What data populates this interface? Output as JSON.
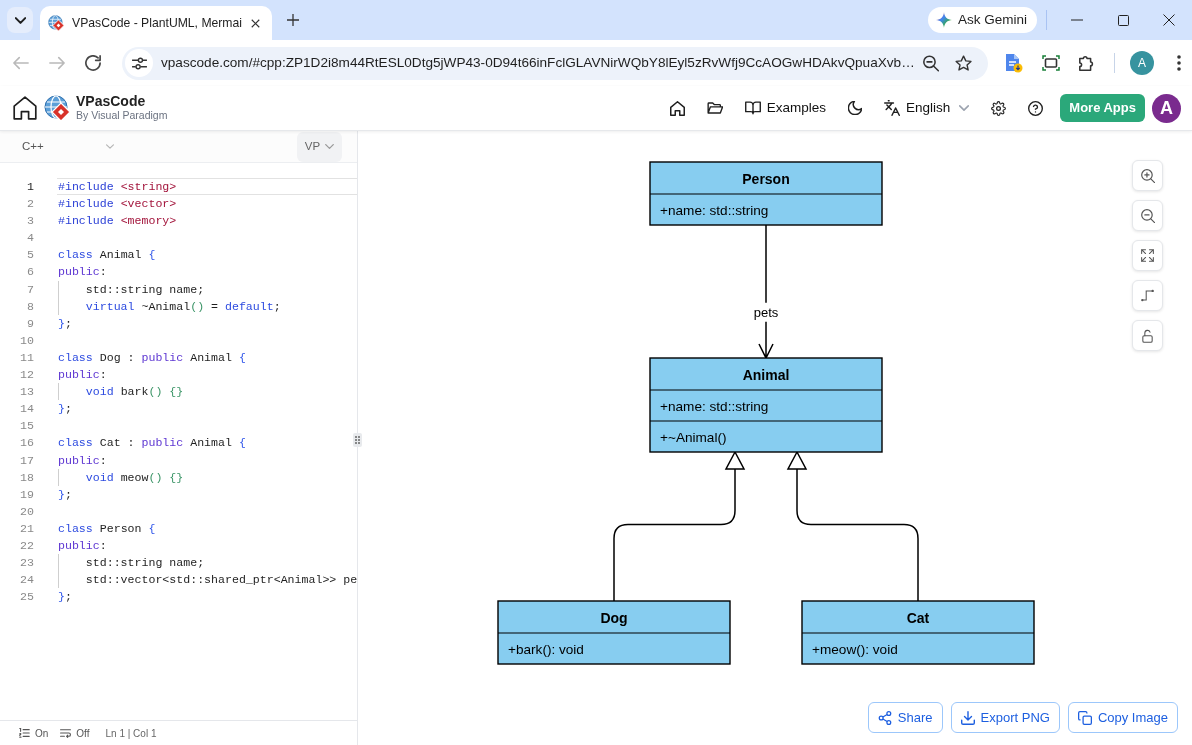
{
  "browser": {
    "tab_title": "VPasCode - PlantUML, Mermai",
    "url": "vpascode.com/#cpp:ZP1D2i8m44RtESL0Dtg5jWP43-0D94t66inFclGLAVNirWQbY8lEyl5zRvWfj9CcAOGwHDAkvQpuaXvb…",
    "back": {
      "disabled": true
    },
    "forward": {
      "disabled": true
    },
    "gemini_button": "Ask Gemini",
    "profile_initial": "A"
  },
  "app_header": {
    "title": "VPasCode",
    "subtitle": "By Visual Paradigm",
    "examples": "Examples",
    "language": "English",
    "more_apps": "More Apps",
    "user_initial": "A"
  },
  "editor": {
    "language": "C++",
    "renderer": "VP",
    "lines": [
      {
        "number": "1",
        "active": true,
        "tokens": [
          {
            "kind": "directive",
            "text": "#include"
          },
          {
            "kind": "header",
            "text": " <string>"
          }
        ]
      },
      {
        "number": "2",
        "active": false,
        "tokens": [
          {
            "kind": "directive",
            "text": "#include"
          },
          {
            "kind": "header",
            "text": " <vector>"
          }
        ]
      },
      {
        "number": "3",
        "active": false,
        "tokens": [
          {
            "kind": "directive",
            "text": "#include"
          },
          {
            "kind": "header",
            "text": " <memory>"
          }
        ]
      },
      {
        "number": "4",
        "active": false
      },
      {
        "number": "5",
        "active": false,
        "tokens": [
          {
            "kind": "keyword",
            "text": "class"
          },
          {
            "kind": "plain",
            "text": " Animal "
          },
          {
            "kind": "bracket1",
            "text": "{"
          }
        ]
      },
      {
        "number": "6",
        "active": false,
        "tokens": [
          {
            "kind": "access",
            "text": "public"
          },
          {
            "kind": "plain",
            "text": ":"
          }
        ]
      },
      {
        "number": "7",
        "active": false,
        "tokens": [
          {
            "kind": "indent"
          },
          {
            "kind": "plain",
            "text": "std::string name;"
          }
        ]
      },
      {
        "number": "8",
        "active": false,
        "tokens": [
          {
            "kind": "indent"
          },
          {
            "kind": "keyword",
            "text": "virtual"
          },
          {
            "kind": "plain",
            "text": " ~Animal"
          },
          {
            "kind": "bracket2",
            "text": "()"
          },
          {
            "kind": "plain",
            "text": " = "
          },
          {
            "kind": "keyword",
            "text": "default"
          },
          {
            "kind": "plain",
            "text": ";"
          }
        ]
      },
      {
        "number": "9",
        "active": false,
        "tokens": [
          {
            "kind": "bracket1",
            "text": "}"
          },
          {
            "kind": "plain",
            "text": ";"
          }
        ]
      },
      {
        "number": "10",
        "active": false
      },
      {
        "number": "11",
        "active": false,
        "tokens": [
          {
            "kind": "keyword",
            "text": "class"
          },
          {
            "kind": "plain",
            "text": " Dog : "
          },
          {
            "kind": "access",
            "text": "public"
          },
          {
            "kind": "plain",
            "text": " Animal "
          },
          {
            "kind": "bracket1",
            "text": "{"
          }
        ]
      },
      {
        "number": "12",
        "active": false,
        "tokens": [
          {
            "kind": "access",
            "text": "public"
          },
          {
            "kind": "plain",
            "text": ":"
          }
        ]
      },
      {
        "number": "13",
        "active": false,
        "tokens": [
          {
            "kind": "indent"
          },
          {
            "kind": "keyword",
            "text": "void"
          },
          {
            "kind": "plain",
            "text": " bark"
          },
          {
            "kind": "bracket2",
            "text": "()"
          },
          {
            "kind": "bracket2",
            "text": " {}"
          }
        ]
      },
      {
        "number": "14",
        "active": false,
        "tokens": [
          {
            "kind": "bracket1",
            "text": "}"
          },
          {
            "kind": "plain",
            "text": ";"
          }
        ]
      },
      {
        "number": "15",
        "active": false
      },
      {
        "number": "16",
        "active": false,
        "tokens": [
          {
            "kind": "keyword",
            "text": "class"
          },
          {
            "kind": "plain",
            "text": " Cat : "
          },
          {
            "kind": "access",
            "text": "public"
          },
          {
            "kind": "plain",
            "text": " Animal "
          },
          {
            "kind": "bracket1",
            "text": "{"
          }
        ]
      },
      {
        "number": "17",
        "active": false,
        "tokens": [
          {
            "kind": "access",
            "text": "public"
          },
          {
            "kind": "plain",
            "text": ":"
          }
        ]
      },
      {
        "number": "18",
        "active": false,
        "tokens": [
          {
            "kind": "indent"
          },
          {
            "kind": "keyword",
            "text": "void"
          },
          {
            "kind": "plain",
            "text": " meow"
          },
          {
            "kind": "bracket2",
            "text": "()"
          },
          {
            "kind": "bracket2",
            "text": " {}"
          }
        ]
      },
      {
        "number": "19",
        "active": false,
        "tokens": [
          {
            "kind": "bracket1",
            "text": "}"
          },
          {
            "kind": "plain",
            "text": ";"
          }
        ]
      },
      {
        "number": "20",
        "active": false
      },
      {
        "number": "21",
        "active": false,
        "tokens": [
          {
            "kind": "keyword",
            "text": "class"
          },
          {
            "kind": "plain",
            "text": " Person "
          },
          {
            "kind": "bracket1",
            "text": "{"
          }
        ]
      },
      {
        "number": "22",
        "active": false,
        "tokens": [
          {
            "kind": "access",
            "text": "public"
          },
          {
            "kind": "plain",
            "text": ":"
          }
        ]
      },
      {
        "number": "23",
        "active": false,
        "tokens": [
          {
            "kind": "indent"
          },
          {
            "kind": "plain",
            "text": "std::string name;"
          }
        ]
      },
      {
        "number": "24",
        "active": false,
        "tokens": [
          {
            "kind": "indent"
          },
          {
            "kind": "plain",
            "text": "std::vector<std::shared_ptr<Animal>> pe"
          }
        ]
      },
      {
        "number": "25",
        "active": false,
        "tokens": [
          {
            "kind": "bracket1",
            "text": "}"
          },
          {
            "kind": "plain",
            "text": ";"
          }
        ]
      }
    ],
    "status_toggles": [
      {
        "kind": "line_numbers",
        "label": "On"
      },
      {
        "kind": "word_wrap",
        "label": "Off"
      }
    ],
    "cursor_position": "Ln 1 | Col 1"
  },
  "diagram": {
    "classes": [
      {
        "name": "Person",
        "attributes": [
          "+name: std::string"
        ],
        "associations": [
          {
            "label": "pets",
            "class": {
              "name": "Animal",
              "attributes": [
                "+name: std::string"
              ],
              "methods": [
                "+~Animal()"
              ],
              "subclasses": [
                {
                  "name": "Dog",
                  "methods": [
                    "+bark(): void"
                  ]
                },
                {
                  "name": "Cat",
                  "methods": [
                    "+meow(): void"
                  ]
                }
              ]
            }
          }
        ]
      }
    ]
  },
  "actions": [
    {
      "kind": "share",
      "label": "Share"
    },
    {
      "kind": "export",
      "label": "Export PNG"
    },
    {
      "kind": "copy",
      "label": "Copy Image"
    }
  ]
}
